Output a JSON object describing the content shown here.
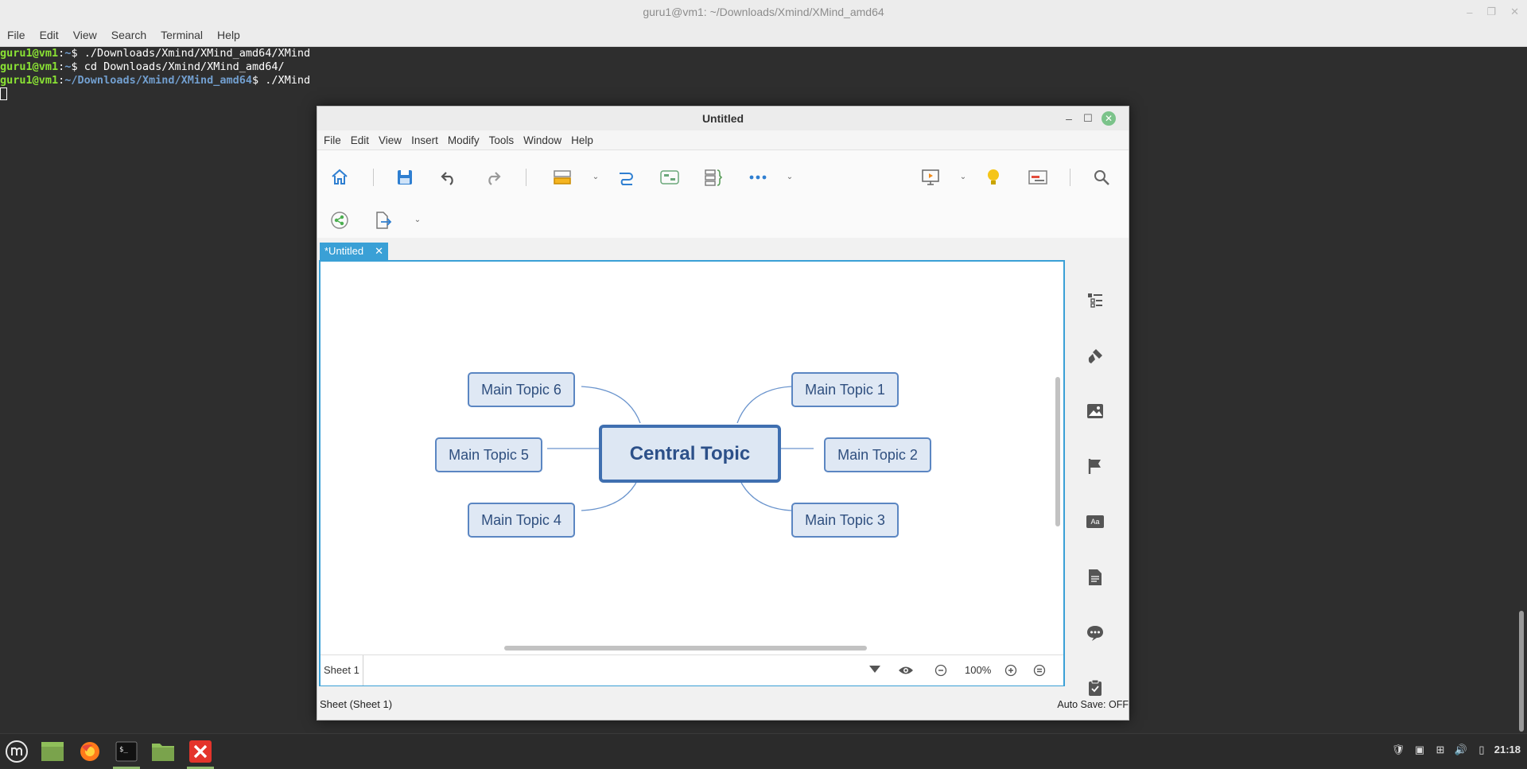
{
  "terminal": {
    "title": "guru1@vm1: ~/Downloads/Xmind/XMind_amd64",
    "window_controls": [
      "–",
      "❐",
      "✕"
    ],
    "menu": [
      "File",
      "Edit",
      "View",
      "Search",
      "Terminal",
      "Help"
    ],
    "lines": [
      {
        "user": "guru1@vm1",
        "path": "~",
        "cmd": "./Downloads/Xmind/XMind_amd64/XMind"
      },
      {
        "user": "guru1@vm1",
        "path": "~",
        "cmd": "cd Downloads/Xmind/XMind_amd64/"
      },
      {
        "user": "guru1@vm1",
        "path": "~/Downloads/Xmind/XMind_amd64",
        "cmd": "./XMind"
      }
    ]
  },
  "xmind": {
    "title": "Untitled",
    "menu": [
      "File",
      "Edit",
      "View",
      "Insert",
      "Modify",
      "Tools",
      "Window",
      "Help"
    ],
    "toolbar_icons": [
      "home-icon",
      "save-icon",
      "undo-icon",
      "redo-icon",
      "topic-icon",
      "relationship-icon",
      "boundary-icon",
      "summary-icon",
      "more-icon",
      "presentation-icon",
      "idea-icon",
      "gantt-icon",
      "search-icon",
      "share-icon",
      "export-icon"
    ],
    "tab_label": "*Untitled",
    "sheet_tab": "Sheet 1",
    "zoom": "100%",
    "status_left": "Sheet (Sheet 1)",
    "status_right": "Auto Save: OFF",
    "map": {
      "central": "Central Topic",
      "topics": [
        "Main Topic 1",
        "Main Topic 2",
        "Main Topic 3",
        "Main Topic 4",
        "Main Topic 5",
        "Main Topic 6"
      ]
    },
    "side_panel_icons": [
      "outline-icon",
      "format-brush-icon",
      "image-icon",
      "marker-flag-icon",
      "label-icon",
      "notes-icon",
      "comments-icon",
      "task-icon"
    ],
    "colors": {
      "accent": "#3aa0d6",
      "topic_border": "#5b86c2",
      "central_border": "#3f6fb0",
      "topic_fill": "#dfe8f4"
    }
  },
  "taskbar": {
    "items": [
      "menu-icon",
      "show-desktop-icon",
      "firefox-icon",
      "terminal-icon",
      "files-icon",
      "xmind-icon"
    ],
    "clock": "21:18"
  }
}
